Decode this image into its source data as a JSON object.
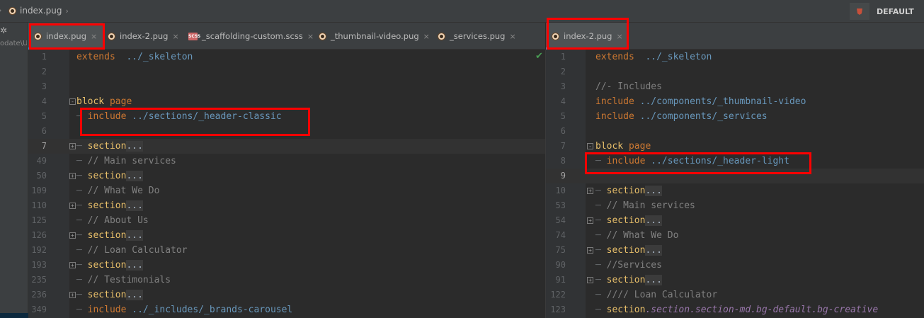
{
  "breadcrumb": {
    "file": "index.pug"
  },
  "profile": {
    "label": "DEFAULT"
  },
  "toolstrip": {
    "text": "odate\\U"
  },
  "left_tabs": [
    {
      "label": "index.pug",
      "icon": "pug-file-icon",
      "active": true,
      "close": "×"
    },
    {
      "label": "index-2.pug",
      "icon": "pug-file-icon",
      "active": false,
      "close": "×"
    },
    {
      "label": "_scaffolding-custom.scss",
      "icon": "scss-file-icon",
      "active": false,
      "close": "×"
    },
    {
      "label": "_thumbnail-video.pug",
      "icon": "pug-file-icon",
      "active": false,
      "close": "×"
    },
    {
      "label": "_services.pug",
      "icon": "pug-file-icon",
      "active": false,
      "close": "×"
    }
  ],
  "right_tabs": [
    {
      "label": "index-2.pug",
      "icon": "pug-file-icon",
      "active": true,
      "close": "×"
    }
  ],
  "left_editor": {
    "lines": [
      {
        "num": "1",
        "tokens": [
          [
            "kw",
            "extends"
          ],
          [
            "plain",
            "  "
          ],
          [
            "path",
            "../_skeleton"
          ]
        ]
      },
      {
        "num": "2",
        "tokens": []
      },
      {
        "num": "3",
        "tokens": []
      },
      {
        "num": "4",
        "fold": "-",
        "tokens": [
          [
            "tag",
            "block"
          ],
          [
            "plain",
            " "
          ],
          [
            "kw",
            "page"
          ]
        ]
      },
      {
        "num": "5",
        "tokens": [
          [
            "dash",
            "─ "
          ],
          [
            "kw",
            "include"
          ],
          [
            "plain",
            " "
          ],
          [
            "path",
            "../sections/_header-classic"
          ]
        ]
      },
      {
        "num": "6",
        "tokens": []
      },
      {
        "num": "7",
        "fold": "+",
        "current": true,
        "tokens": [
          [
            "dash",
            "─ "
          ],
          [
            "tag",
            "section"
          ],
          [
            "ell",
            "..."
          ]
        ]
      },
      {
        "num": "49",
        "tokens": [
          [
            "dash",
            "─ "
          ],
          [
            "cm",
            "// Main services"
          ]
        ]
      },
      {
        "num": "50",
        "fold": "+",
        "tokens": [
          [
            "dash",
            "─ "
          ],
          [
            "tag",
            "section"
          ],
          [
            "ell",
            "..."
          ]
        ]
      },
      {
        "num": "109",
        "tokens": [
          [
            "dash",
            "─ "
          ],
          [
            "cm",
            "// What We Do"
          ]
        ]
      },
      {
        "num": "110",
        "fold": "+",
        "tokens": [
          [
            "dash",
            "─ "
          ],
          [
            "tag",
            "section"
          ],
          [
            "ell",
            "..."
          ]
        ]
      },
      {
        "num": "125",
        "tokens": [
          [
            "dash",
            "─ "
          ],
          [
            "cm",
            "// About Us"
          ]
        ]
      },
      {
        "num": "126",
        "fold": "+",
        "tokens": [
          [
            "dash",
            "─ "
          ],
          [
            "tag",
            "section"
          ],
          [
            "ell",
            "..."
          ]
        ]
      },
      {
        "num": "192",
        "tokens": [
          [
            "dash",
            "─ "
          ],
          [
            "cm",
            "// Loan Calculator"
          ]
        ]
      },
      {
        "num": "193",
        "fold": "+",
        "tokens": [
          [
            "dash",
            "─ "
          ],
          [
            "tag",
            "section"
          ],
          [
            "ell",
            "..."
          ]
        ]
      },
      {
        "num": "235",
        "tokens": [
          [
            "dash",
            "─ "
          ],
          [
            "cm",
            "// Testimonials"
          ]
        ]
      },
      {
        "num": "236",
        "fold": "+",
        "tokens": [
          [
            "dash",
            "─ "
          ],
          [
            "tag",
            "section"
          ],
          [
            "ell",
            "..."
          ]
        ]
      },
      {
        "num": "349",
        "tokens": [
          [
            "dash",
            "─ "
          ],
          [
            "kw",
            "include"
          ],
          [
            "plain",
            " "
          ],
          [
            "path",
            "../_includes/_brands-carousel"
          ]
        ]
      }
    ]
  },
  "right_editor": {
    "lines": [
      {
        "num": "1",
        "tokens": [
          [
            "kw",
            "extends"
          ],
          [
            "plain",
            "  "
          ],
          [
            "path",
            "../_skeleton"
          ]
        ]
      },
      {
        "num": "2",
        "tokens": []
      },
      {
        "num": "3",
        "tokens": [
          [
            "cm",
            "//- Includes"
          ]
        ]
      },
      {
        "num": "4",
        "tokens": [
          [
            "kw",
            "include"
          ],
          [
            "plain",
            " "
          ],
          [
            "path",
            "../components/_thumbnail-video"
          ]
        ]
      },
      {
        "num": "5",
        "tokens": [
          [
            "kw",
            "include"
          ],
          [
            "plain",
            " "
          ],
          [
            "path",
            "../components/_services"
          ]
        ]
      },
      {
        "num": "6",
        "tokens": []
      },
      {
        "num": "7",
        "fold": "-",
        "tokens": [
          [
            "tag",
            "block"
          ],
          [
            "plain",
            " "
          ],
          [
            "kw",
            "page"
          ]
        ]
      },
      {
        "num": "8",
        "tokens": [
          [
            "dash",
            "─ "
          ],
          [
            "kw",
            "include"
          ],
          [
            "plain",
            " "
          ],
          [
            "path",
            "../sections/_header-light"
          ]
        ]
      },
      {
        "num": "9",
        "current": true,
        "tokens": []
      },
      {
        "num": "10",
        "fold": "+",
        "tokens": [
          [
            "dash",
            "─ "
          ],
          [
            "tag",
            "section"
          ],
          [
            "ell",
            "..."
          ]
        ]
      },
      {
        "num": "53",
        "tokens": [
          [
            "dash",
            "─ "
          ],
          [
            "cm",
            "// Main services"
          ]
        ]
      },
      {
        "num": "54",
        "fold": "+",
        "tokens": [
          [
            "dash",
            "─ "
          ],
          [
            "tag",
            "section"
          ],
          [
            "ell",
            "..."
          ]
        ]
      },
      {
        "num": "74",
        "tokens": [
          [
            "dash",
            "─ "
          ],
          [
            "cm",
            "// What We Do"
          ]
        ]
      },
      {
        "num": "75",
        "fold": "+",
        "tokens": [
          [
            "dash",
            "─ "
          ],
          [
            "tag",
            "section"
          ],
          [
            "ell",
            "..."
          ]
        ]
      },
      {
        "num": "90",
        "tokens": [
          [
            "dash",
            "─ "
          ],
          [
            "cm",
            "//Services"
          ]
        ]
      },
      {
        "num": "91",
        "fold": "+",
        "tokens": [
          [
            "dash",
            "─ "
          ],
          [
            "tag",
            "section"
          ],
          [
            "ell",
            "..."
          ]
        ]
      },
      {
        "num": "122",
        "tokens": [
          [
            "dash",
            "─ "
          ],
          [
            "cm",
            "//// Loan Calculator"
          ]
        ]
      },
      {
        "num": "123",
        "tokens": [
          [
            "dash",
            "─ "
          ],
          [
            "tag",
            "section"
          ],
          [
            "cls",
            ".section.section-md.bg-default.bg-creative"
          ]
        ]
      }
    ]
  },
  "colors": {
    "highlight": "#ff0000",
    "accent": "#4a88c7"
  }
}
